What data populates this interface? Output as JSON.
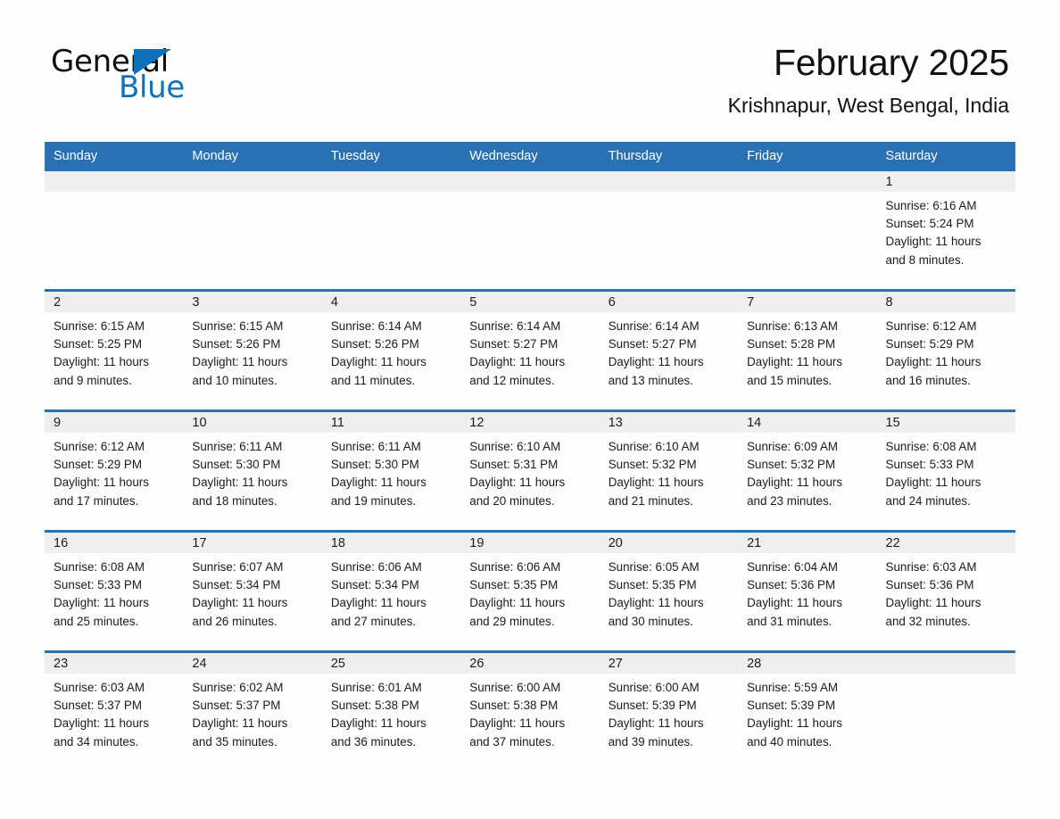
{
  "brand": {
    "name_part1": "General",
    "name_part2": "Blue",
    "accent_color": "#0d72b9"
  },
  "header": {
    "title": "February 2025",
    "subtitle": "Krishnapur, West Bengal, India"
  },
  "theme": {
    "header_row_color": "#2a71b3",
    "daynum_strip_color": "#efefef",
    "page_background": "#fdfdfd"
  },
  "weekday_headers": [
    "Sunday",
    "Monday",
    "Tuesday",
    "Wednesday",
    "Thursday",
    "Friday",
    "Saturday"
  ],
  "weeks": [
    [
      {
        "day": "",
        "empty": true
      },
      {
        "day": "",
        "empty": true
      },
      {
        "day": "",
        "empty": true
      },
      {
        "day": "",
        "empty": true
      },
      {
        "day": "",
        "empty": true
      },
      {
        "day": "",
        "empty": true
      },
      {
        "day": "1",
        "sunrise": "Sunrise: 6:16 AM",
        "sunset": "Sunset: 5:24 PM",
        "daylight_line1": "Daylight: 11 hours",
        "daylight_line2": "and 8 minutes."
      }
    ],
    [
      {
        "day": "2",
        "sunrise": "Sunrise: 6:15 AM",
        "sunset": "Sunset: 5:25 PM",
        "daylight_line1": "Daylight: 11 hours",
        "daylight_line2": "and 9 minutes."
      },
      {
        "day": "3",
        "sunrise": "Sunrise: 6:15 AM",
        "sunset": "Sunset: 5:26 PM",
        "daylight_line1": "Daylight: 11 hours",
        "daylight_line2": "and 10 minutes."
      },
      {
        "day": "4",
        "sunrise": "Sunrise: 6:14 AM",
        "sunset": "Sunset: 5:26 PM",
        "daylight_line1": "Daylight: 11 hours",
        "daylight_line2": "and 11 minutes."
      },
      {
        "day": "5",
        "sunrise": "Sunrise: 6:14 AM",
        "sunset": "Sunset: 5:27 PM",
        "daylight_line1": "Daylight: 11 hours",
        "daylight_line2": "and 12 minutes."
      },
      {
        "day": "6",
        "sunrise": "Sunrise: 6:14 AM",
        "sunset": "Sunset: 5:27 PM",
        "daylight_line1": "Daylight: 11 hours",
        "daylight_line2": "and 13 minutes."
      },
      {
        "day": "7",
        "sunrise": "Sunrise: 6:13 AM",
        "sunset": "Sunset: 5:28 PM",
        "daylight_line1": "Daylight: 11 hours",
        "daylight_line2": "and 15 minutes."
      },
      {
        "day": "8",
        "sunrise": "Sunrise: 6:12 AM",
        "sunset": "Sunset: 5:29 PM",
        "daylight_line1": "Daylight: 11 hours",
        "daylight_line2": "and 16 minutes."
      }
    ],
    [
      {
        "day": "9",
        "sunrise": "Sunrise: 6:12 AM",
        "sunset": "Sunset: 5:29 PM",
        "daylight_line1": "Daylight: 11 hours",
        "daylight_line2": "and 17 minutes."
      },
      {
        "day": "10",
        "sunrise": "Sunrise: 6:11 AM",
        "sunset": "Sunset: 5:30 PM",
        "daylight_line1": "Daylight: 11 hours",
        "daylight_line2": "and 18 minutes."
      },
      {
        "day": "11",
        "sunrise": "Sunrise: 6:11 AM",
        "sunset": "Sunset: 5:30 PM",
        "daylight_line1": "Daylight: 11 hours",
        "daylight_line2": "and 19 minutes."
      },
      {
        "day": "12",
        "sunrise": "Sunrise: 6:10 AM",
        "sunset": "Sunset: 5:31 PM",
        "daylight_line1": "Daylight: 11 hours",
        "daylight_line2": "and 20 minutes."
      },
      {
        "day": "13",
        "sunrise": "Sunrise: 6:10 AM",
        "sunset": "Sunset: 5:32 PM",
        "daylight_line1": "Daylight: 11 hours",
        "daylight_line2": "and 21 minutes."
      },
      {
        "day": "14",
        "sunrise": "Sunrise: 6:09 AM",
        "sunset": "Sunset: 5:32 PM",
        "daylight_line1": "Daylight: 11 hours",
        "daylight_line2": "and 23 minutes."
      },
      {
        "day": "15",
        "sunrise": "Sunrise: 6:08 AM",
        "sunset": "Sunset: 5:33 PM",
        "daylight_line1": "Daylight: 11 hours",
        "daylight_line2": "and 24 minutes."
      }
    ],
    [
      {
        "day": "16",
        "sunrise": "Sunrise: 6:08 AM",
        "sunset": "Sunset: 5:33 PM",
        "daylight_line1": "Daylight: 11 hours",
        "daylight_line2": "and 25 minutes."
      },
      {
        "day": "17",
        "sunrise": "Sunrise: 6:07 AM",
        "sunset": "Sunset: 5:34 PM",
        "daylight_line1": "Daylight: 11 hours",
        "daylight_line2": "and 26 minutes."
      },
      {
        "day": "18",
        "sunrise": "Sunrise: 6:06 AM",
        "sunset": "Sunset: 5:34 PM",
        "daylight_line1": "Daylight: 11 hours",
        "daylight_line2": "and 27 minutes."
      },
      {
        "day": "19",
        "sunrise": "Sunrise: 6:06 AM",
        "sunset": "Sunset: 5:35 PM",
        "daylight_line1": "Daylight: 11 hours",
        "daylight_line2": "and 29 minutes."
      },
      {
        "day": "20",
        "sunrise": "Sunrise: 6:05 AM",
        "sunset": "Sunset: 5:35 PM",
        "daylight_line1": "Daylight: 11 hours",
        "daylight_line2": "and 30 minutes."
      },
      {
        "day": "21",
        "sunrise": "Sunrise: 6:04 AM",
        "sunset": "Sunset: 5:36 PM",
        "daylight_line1": "Daylight: 11 hours",
        "daylight_line2": "and 31 minutes."
      },
      {
        "day": "22",
        "sunrise": "Sunrise: 6:03 AM",
        "sunset": "Sunset: 5:36 PM",
        "daylight_line1": "Daylight: 11 hours",
        "daylight_line2": "and 32 minutes."
      }
    ],
    [
      {
        "day": "23",
        "sunrise": "Sunrise: 6:03 AM",
        "sunset": "Sunset: 5:37 PM",
        "daylight_line1": "Daylight: 11 hours",
        "daylight_line2": "and 34 minutes."
      },
      {
        "day": "24",
        "sunrise": "Sunrise: 6:02 AM",
        "sunset": "Sunset: 5:37 PM",
        "daylight_line1": "Daylight: 11 hours",
        "daylight_line2": "and 35 minutes."
      },
      {
        "day": "25",
        "sunrise": "Sunrise: 6:01 AM",
        "sunset": "Sunset: 5:38 PM",
        "daylight_line1": "Daylight: 11 hours",
        "daylight_line2": "and 36 minutes."
      },
      {
        "day": "26",
        "sunrise": "Sunrise: 6:00 AM",
        "sunset": "Sunset: 5:38 PM",
        "daylight_line1": "Daylight: 11 hours",
        "daylight_line2": "and 37 minutes."
      },
      {
        "day": "27",
        "sunrise": "Sunrise: 6:00 AM",
        "sunset": "Sunset: 5:39 PM",
        "daylight_line1": "Daylight: 11 hours",
        "daylight_line2": "and 39 minutes."
      },
      {
        "day": "28",
        "sunrise": "Sunrise: 5:59 AM",
        "sunset": "Sunset: 5:39 PM",
        "daylight_line1": "Daylight: 11 hours",
        "daylight_line2": "and 40 minutes."
      },
      {
        "day": "",
        "empty": true
      }
    ]
  ]
}
